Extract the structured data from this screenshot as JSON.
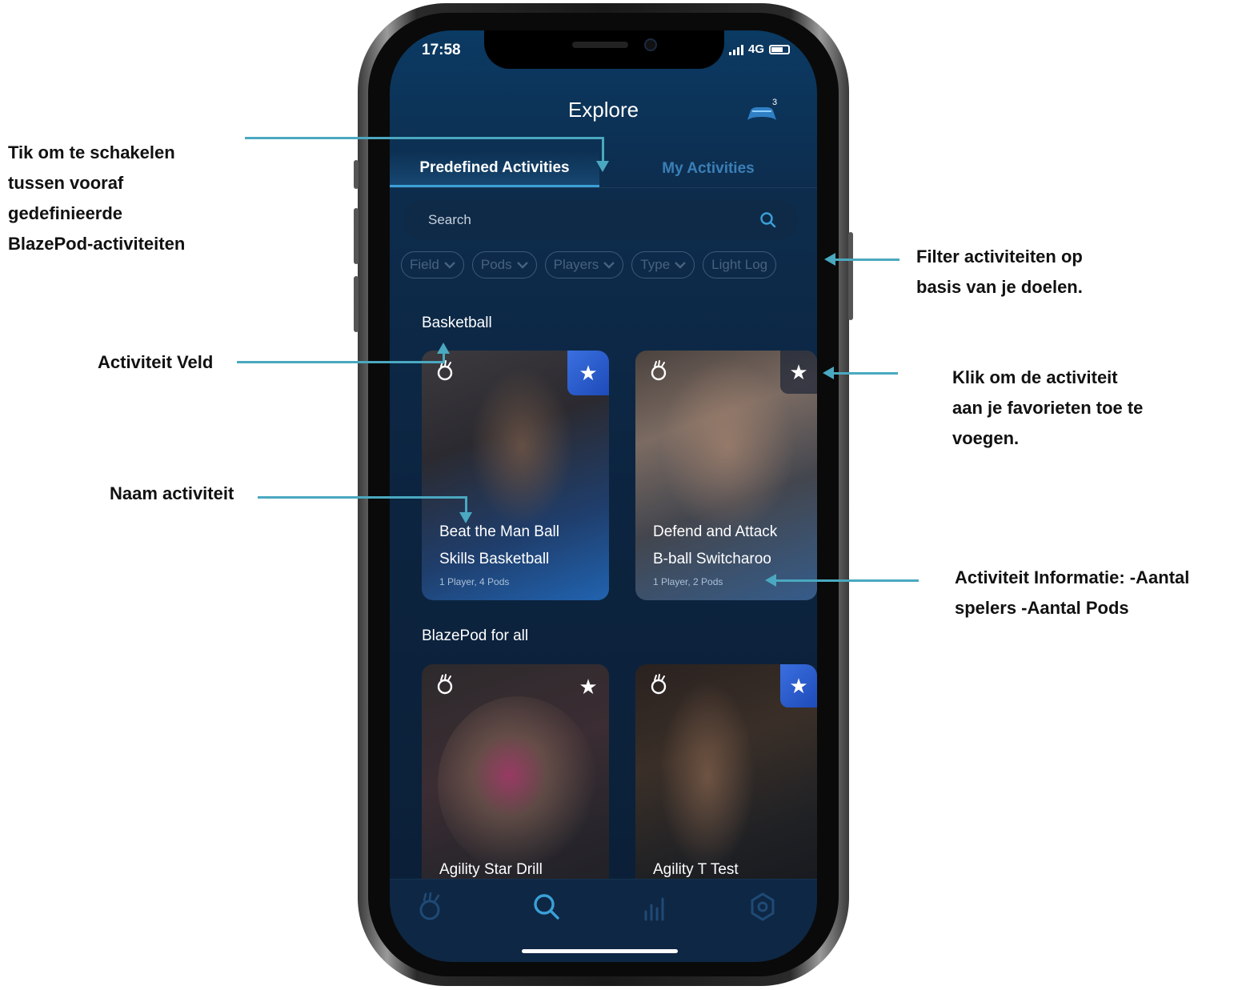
{
  "annotations": {
    "tab_switch": [
      "Tik om te schakelen",
      "tussen vooraf",
      "gedefinieerde",
      "BlazePod-activiteiten"
    ],
    "field": "Activiteit Veld",
    "name": "Naam activiteit",
    "filter": [
      "Filter activiteiten op",
      "basis van je doelen."
    ],
    "favorite": [
      "Klik om de activiteit",
      "aan je favorieten toe te",
      "voegen."
    ],
    "info": [
      "Activiteit Informatie: -Aantal",
      "spelers -Aantal Pods"
    ]
  },
  "status_bar": {
    "time": "17:58",
    "network": "4G"
  },
  "header": {
    "title": "Explore",
    "pods_count": "3"
  },
  "tabs": [
    {
      "label": "Predefined Activities",
      "active": true
    },
    {
      "label": "My Activities",
      "active": false
    }
  ],
  "search": {
    "placeholder": "Search"
  },
  "filters": [
    "Field",
    "Pods",
    "Players",
    "Type",
    "Light Log"
  ],
  "sections": [
    {
      "title": "Basketball",
      "cards": [
        {
          "title_line1": "Beat the Man Ball",
          "title_line2": "Skills Basketball",
          "info": "1 Player, 4 Pods",
          "favorite": true
        },
        {
          "title_line1": "Defend and Attack",
          "title_line2": "B-ball Switcharoo",
          "info": "1 Player, 2 Pods",
          "favorite": false
        }
      ]
    },
    {
      "title": "BlazePod for all",
      "cards": [
        {
          "title_line1": "Agility Star Drill",
          "favorite": false
        },
        {
          "title_line1": "Agility T Test",
          "favorite": true
        }
      ]
    }
  ],
  "bottom_nav": [
    "pod-icon",
    "search-icon",
    "stats-icon",
    "settings-icon"
  ],
  "colors": {
    "accent": "#3aa0d8",
    "annotation_line": "#4aa8c0",
    "favorite_active": "#2e5fd6"
  }
}
